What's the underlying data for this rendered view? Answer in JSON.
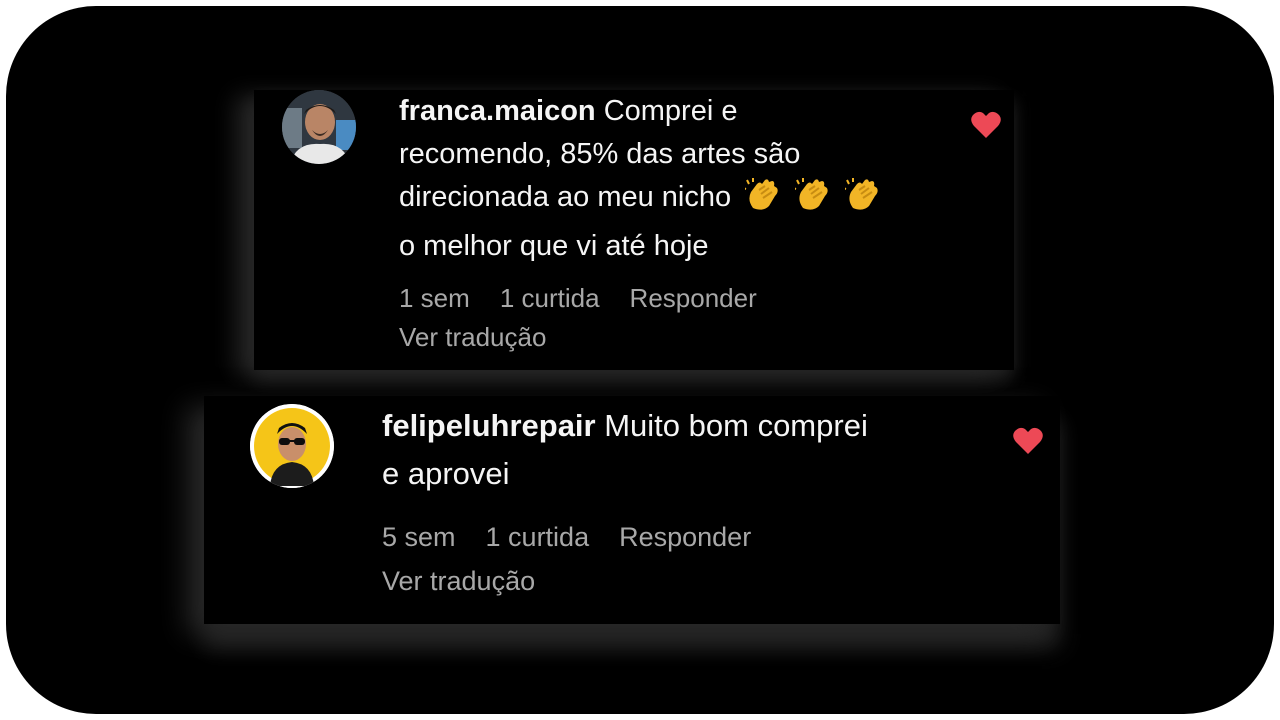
{
  "colors": {
    "background": "#000000",
    "text": "#f5f5f5",
    "meta_text": "#a8a8a8",
    "heart": "#ed4956",
    "avatar2_ring": "#f5c518"
  },
  "comments": [
    {
      "username": "franca.maicon",
      "text_line1": "Comprei e",
      "text_line2": "recomendo, 85% das artes são",
      "text_line3": "direcionada ao meu nicho",
      "emojis": [
        "clapping-hands",
        "clapping-hands",
        "clapping-hands"
      ],
      "text_line4": "o melhor que vi até hoje",
      "time": "1 sem",
      "likes": "1 curtida",
      "reply_label": "Responder",
      "translate_label": "Ver tradução",
      "liked": true
    },
    {
      "username": "felipeluhrepair",
      "text_line1": "Muito bom comprei",
      "text_line2": "e aprovei",
      "time": "5 sem",
      "likes": "1 curtida",
      "reply_label": "Responder",
      "translate_label": "Ver tradução",
      "liked": true
    }
  ]
}
